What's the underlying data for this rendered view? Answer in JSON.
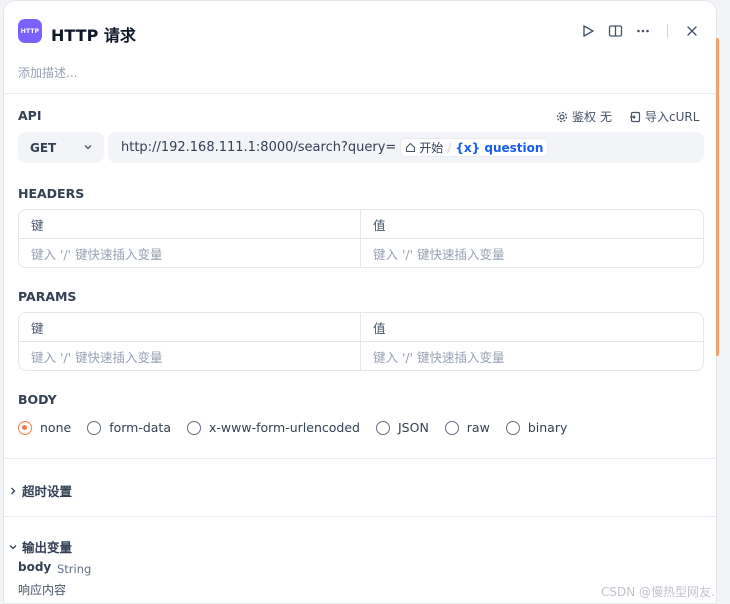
{
  "header": {
    "app_icon_text": "HTTP",
    "title": "HTTP 请求",
    "description_placeholder": "添加描述..."
  },
  "api": {
    "label": "API",
    "auth_label": "鉴权",
    "auth_value": "无",
    "import_curl_label": "导入cURL",
    "method": "GET",
    "url_prefix": "http://192.168.111.1:8000/search?query=",
    "var_node": "开始",
    "var_sep": "/",
    "var_name": "{x} question"
  },
  "headers": {
    "label": "HEADERS",
    "key_header": "键",
    "value_header": "值",
    "key_placeholder": "键入 '/' 键快速插入变量",
    "value_placeholder": "键入 '/' 键快速插入变量"
  },
  "params": {
    "label": "PARAMS",
    "key_header": "键",
    "value_header": "值",
    "key_placeholder": "键入 '/' 键快速插入变量",
    "value_placeholder": "键入 '/' 键快速插入变量"
  },
  "body": {
    "label": "BODY",
    "options": [
      "none",
      "form-data",
      "x-www-form-urlencoded",
      "JSON",
      "raw",
      "binary"
    ],
    "selected": "none"
  },
  "timeout": {
    "label": "超时设置"
  },
  "output": {
    "label": "输出变量",
    "var_name": "body",
    "var_type": "String",
    "var_desc": "响应内容"
  },
  "watermark": "CSDN @慢热型网友."
}
